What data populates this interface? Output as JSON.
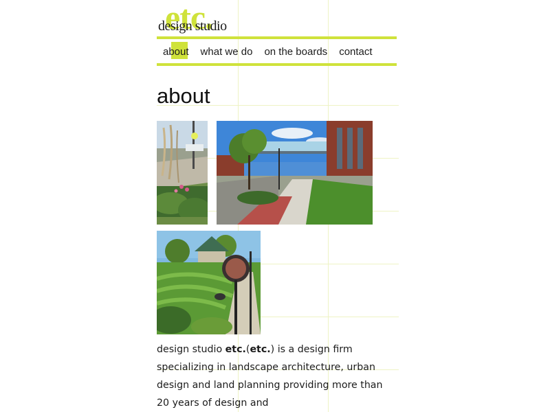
{
  "colors": {
    "accent": "#cfe23b",
    "text": "#1b1b1b",
    "guide": "#eef3c4"
  },
  "logo": {
    "mark": "etc.",
    "text": "design studio"
  },
  "nav": {
    "items": [
      {
        "label": "about",
        "active": true
      },
      {
        "label": "what we do",
        "active": false
      },
      {
        "label": "on the boards",
        "active": false
      },
      {
        "label": "contact",
        "active": false
      }
    ]
  },
  "page": {
    "title": "about"
  },
  "photos": [
    {
      "name": "roadside-planting-photo",
      "icon": "landscape-photo"
    },
    {
      "name": "urban-streetscape-photo",
      "icon": "landscape-photo"
    },
    {
      "name": "park-lamppost-photo",
      "icon": "landscape-photo"
    }
  ],
  "intro": {
    "part1": "design studio ",
    "brand1": "etc.",
    "paren_open": "(",
    "brand2": "etc.",
    "part2": ") is a design firm specializing in landscape architecture, urban design and land planning providing more than 20 years of design and"
  }
}
